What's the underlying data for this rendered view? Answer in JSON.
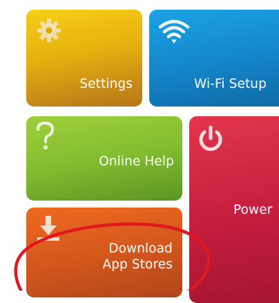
{
  "tiles": {
    "settings": {
      "label": "Settings",
      "icon": "gear-icon",
      "color": "#e6b00f"
    },
    "wifi": {
      "label": "Wi-Fi Setup",
      "icon": "wifi-icon",
      "color": "#1488cb"
    },
    "help": {
      "label": "Online Help",
      "icon": "question-mark-icon",
      "color": "#82bd30"
    },
    "power": {
      "label": "Power",
      "icon": "power-icon",
      "color": "#c81f3e"
    },
    "download": {
      "label_line1": "Download",
      "label_line2": "App Stores",
      "icon": "download-icon",
      "color": "#d2561c"
    }
  },
  "annotation": {
    "shape": "ellipse",
    "color": "#e0191f"
  }
}
